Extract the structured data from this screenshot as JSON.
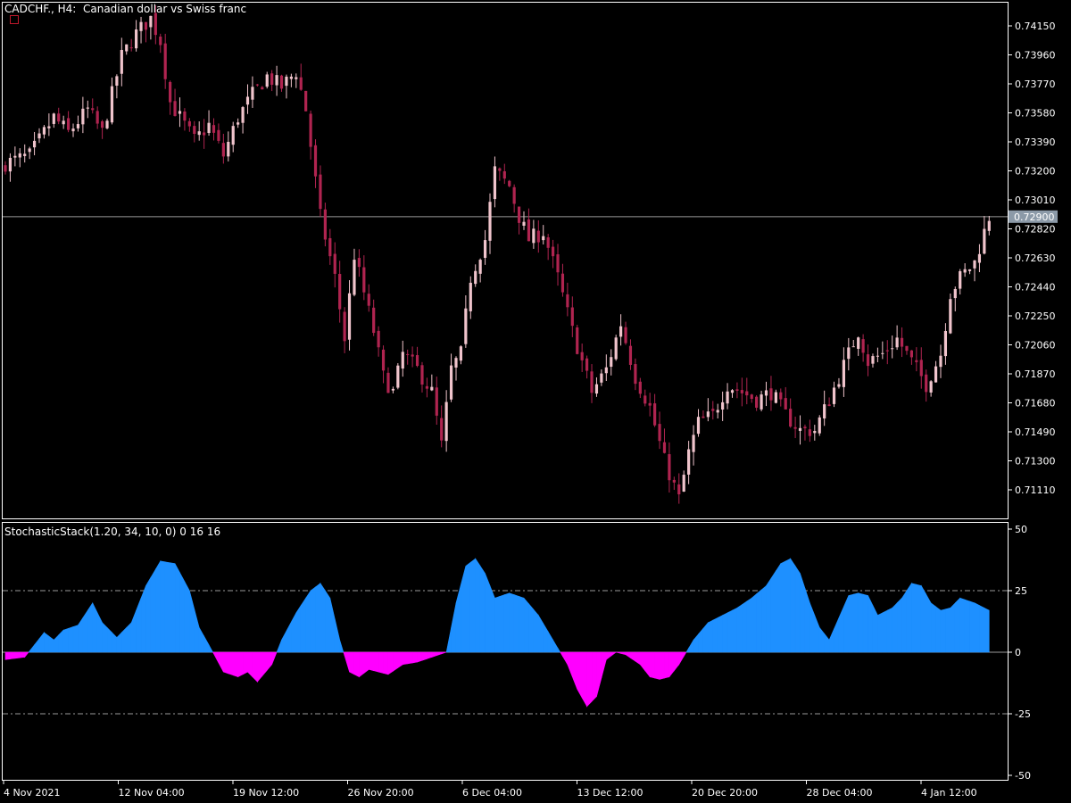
{
  "window": {
    "symbol_title": "CADCHF., H4:  Canadian dollar vs Swiss franc",
    "indicator_title": "StochasticStack(1.20, 34, 10, 0) 0 16 16"
  },
  "colors": {
    "background": "#000000",
    "frame": "#ffffff",
    "bull_candle": "#f0c4cc",
    "bear_candle": "#b02450",
    "price_line": "#9a9a9a",
    "price_label_bg": "#8c9aa8",
    "positive_fill": "#1e90ff",
    "negative_fill": "#ff00ff",
    "level_lines": "#9a9a9a"
  },
  "price_axis": {
    "labels": [
      "0.74150",
      "0.73960",
      "0.73770",
      "0.73580",
      "0.73390",
      "0.73200",
      "0.73010",
      "0.72820",
      "0.72630",
      "0.72440",
      "0.72250",
      "0.72060",
      "0.71870",
      "0.71680",
      "0.71490",
      "0.71300",
      "0.71110"
    ],
    "current_price": "0.72900"
  },
  "indicator_axis": {
    "labels": [
      "50",
      "25",
      "0",
      "-25",
      "-50"
    ]
  },
  "time_axis": {
    "labels": [
      "4 Nov 2021",
      "12 Nov 04:00",
      "19 Nov 12:00",
      "26 Nov 20:00",
      "6 Dec 04:00",
      "13 Dec 12:00",
      "20 Dec 20:00",
      "28 Dec 04:00",
      "4 Jan 12:00"
    ]
  },
  "chart_data": [
    {
      "type": "candlestick",
      "title": "CADCHF., H4:  Canadian dollar vs Swiss franc",
      "ylim": [
        0.7102,
        0.7427
      ],
      "close_path": [
        [
          0,
          0.7325
        ],
        [
          5,
          0.733
        ],
        [
          10,
          0.7355
        ],
        [
          13,
          0.7345
        ],
        [
          17,
          0.736
        ],
        [
          20,
          0.7345
        ],
        [
          24,
          0.7395
        ],
        [
          27,
          0.741
        ],
        [
          30,
          0.742
        ],
        [
          32,
          0.7405
        ],
        [
          34,
          0.7365
        ],
        [
          37,
          0.735
        ],
        [
          39,
          0.734
        ],
        [
          42,
          0.735
        ],
        [
          45,
          0.733
        ],
        [
          48,
          0.7355
        ],
        [
          51,
          0.737
        ],
        [
          54,
          0.7382
        ],
        [
          57,
          0.7375
        ],
        [
          60,
          0.7385
        ],
        [
          62,
          0.736
        ],
        [
          65,
          0.729
        ],
        [
          68,
          0.725
        ],
        [
          70,
          0.721
        ],
        [
          72,
          0.7265
        ],
        [
          74,
          0.724
        ],
        [
          76,
          0.7215
        ],
        [
          78,
          0.7185
        ],
        [
          80,
          0.7175
        ],
        [
          82,
          0.72
        ],
        [
          85,
          0.719
        ],
        [
          88,
          0.7175
        ],
        [
          90,
          0.714
        ],
        [
          92,
          0.719
        ],
        [
          94,
          0.72
        ],
        [
          96,
          0.725
        ],
        [
          99,
          0.7275
        ],
        [
          101,
          0.732
        ],
        [
          104,
          0.731
        ],
        [
          106,
          0.729
        ],
        [
          108,
          0.7275
        ],
        [
          111,
          0.728
        ],
        [
          114,
          0.725
        ],
        [
          117,
          0.7215
        ],
        [
          119,
          0.7195
        ],
        [
          121,
          0.7175
        ],
        [
          124,
          0.719
        ],
        [
          127,
          0.722
        ],
        [
          130,
          0.7185
        ],
        [
          133,
          0.7165
        ],
        [
          136,
          0.713
        ],
        [
          139,
          0.7105
        ],
        [
          141,
          0.7135
        ],
        [
          143,
          0.7155
        ],
        [
          146,
          0.716
        ],
        [
          149,
          0.718
        ],
        [
          152,
          0.7175
        ],
        [
          155,
          0.717
        ],
        [
          158,
          0.7175
        ],
        [
          161,
          0.716
        ],
        [
          164,
          0.715
        ],
        [
          167,
          0.715
        ],
        [
          170,
          0.717
        ],
        [
          172,
          0.7185
        ],
        [
          174,
          0.72
        ],
        [
          176,
          0.7215
        ],
        [
          178,
          0.7195
        ],
        [
          181,
          0.72
        ],
        [
          184,
          0.721
        ],
        [
          187,
          0.7195
        ],
        [
          190,
          0.718
        ],
        [
          193,
          0.72
        ],
        [
          195,
          0.724
        ],
        [
          197,
          0.725
        ],
        [
          200,
          0.726
        ],
        [
          203,
          0.729
        ]
      ]
    },
    {
      "type": "area",
      "title": "StochasticStack(1.20, 34, 10, 0) 0 16 16",
      "ylim": [
        -50,
        50
      ],
      "levels": [
        25,
        0,
        -25
      ],
      "series": [
        {
          "path": [
            [
              0,
              -3
            ],
            [
              4,
              -2
            ],
            [
              8,
              8
            ],
            [
              10,
              5
            ],
            [
              12,
              9
            ],
            [
              15,
              11
            ],
            [
              18,
              20
            ],
            [
              20,
              12
            ],
            [
              23,
              6
            ],
            [
              26,
              12
            ],
            [
              29,
              27
            ],
            [
              32,
              37
            ],
            [
              35,
              36
            ],
            [
              38,
              25
            ],
            [
              40,
              10
            ],
            [
              42,
              3
            ],
            [
              45,
              -8
            ],
            [
              48,
              -10
            ],
            [
              50,
              -8
            ],
            [
              52,
              -12
            ],
            [
              55,
              -5
            ],
            [
              57,
              5
            ],
            [
              60,
              16
            ],
            [
              63,
              25
            ],
            [
              65,
              28
            ],
            [
              67,
              22
            ],
            [
              69,
              5
            ],
            [
              71,
              -8
            ],
            [
              73,
              -10
            ],
            [
              75,
              -7
            ],
            [
              77,
              -8
            ],
            [
              79,
              -9
            ],
            [
              82,
              -5
            ],
            [
              85,
              -4
            ],
            [
              88,
              -2
            ],
            [
              91,
              0
            ],
            [
              93,
              20
            ],
            [
              95,
              35
            ],
            [
              97,
              38
            ],
            [
              99,
              32
            ],
            [
              101,
              22
            ],
            [
              104,
              24
            ],
            [
              107,
              22
            ],
            [
              110,
              15
            ],
            [
              113,
              5
            ],
            [
              116,
              -5
            ],
            [
              118,
              -15
            ],
            [
              120,
              -22
            ],
            [
              122,
              -18
            ],
            [
              124,
              -3
            ],
            [
              126,
              0
            ],
            [
              128,
              -1
            ],
            [
              131,
              -5
            ],
            [
              133,
              -10
            ],
            [
              135,
              -11
            ],
            [
              137,
              -10
            ],
            [
              139,
              -5
            ],
            [
              142,
              5
            ],
            [
              145,
              12
            ],
            [
              148,
              15
            ],
            [
              151,
              18
            ],
            [
              154,
              22
            ],
            [
              157,
              27
            ],
            [
              160,
              36
            ],
            [
              162,
              38
            ],
            [
              164,
              32
            ],
            [
              166,
              20
            ],
            [
              168,
              10
            ],
            [
              170,
              5
            ],
            [
              172,
              14
            ],
            [
              174,
              23
            ],
            [
              176,
              24
            ],
            [
              178,
              23
            ],
            [
              180,
              15
            ],
            [
              183,
              18
            ],
            [
              185,
              22
            ],
            [
              187,
              28
            ],
            [
              189,
              27
            ],
            [
              191,
              20
            ],
            [
              193,
              17
            ],
            [
              195,
              18
            ],
            [
              197,
              22
            ],
            [
              200,
              20
            ],
            [
              203,
              17
            ]
          ]
        }
      ]
    }
  ]
}
